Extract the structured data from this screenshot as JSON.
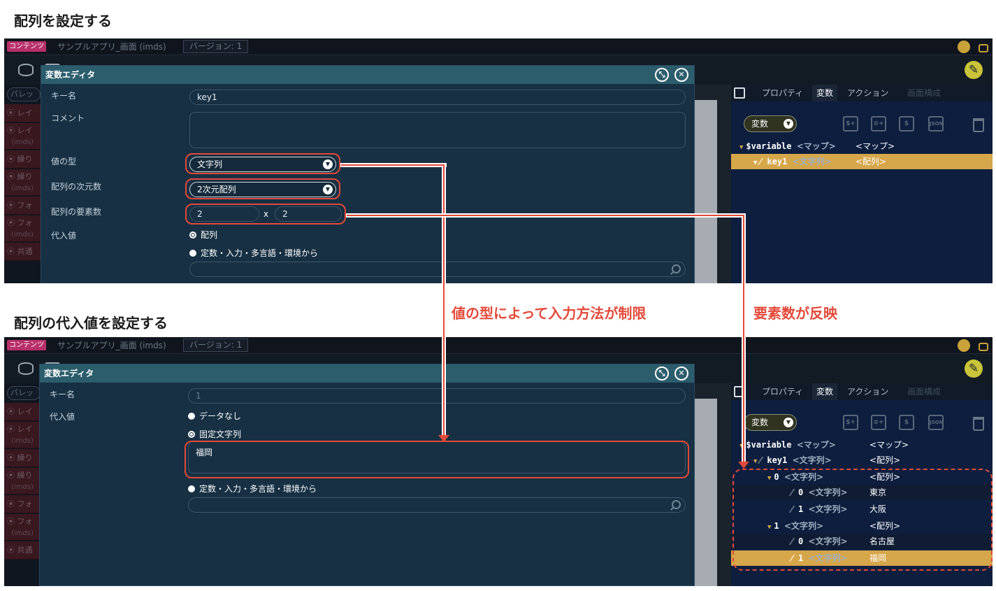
{
  "section1_heading": "配列を設定する",
  "section2_heading": "配列の代入値を設定する",
  "annotation_left": "値の型によって入力方法が制限",
  "annotation_right": "要素数が反映",
  "app": {
    "badge": "コンテンツ",
    "title": "サンプルアプリ_画面 (imds)",
    "version": "バージョン: 1"
  },
  "left_panel": {
    "search_placeholder": "パレッ",
    "items": [
      {
        "label": "⦿ レイ",
        "sub": ""
      },
      {
        "label": "⦿ レイ",
        "sub": "(imds)"
      },
      {
        "label": "⦿ 繰り",
        "sub": ""
      },
      {
        "label": "⦿ 繰り",
        "sub": "(imds)"
      },
      {
        "label": "⦿ フォ",
        "sub": ""
      },
      {
        "label": "⦿ フォ",
        "sub": "(imds)"
      },
      {
        "label": "⦿ 共通",
        "sub": ""
      }
    ]
  },
  "right_panel": {
    "tabs": [
      "プロパティ",
      "変数",
      "アクション",
      "画面構成"
    ],
    "var_button": "変数",
    "icons": [
      "$+",
      "≡+",
      "$",
      "JSON"
    ],
    "tree1": [
      {
        "key": "$variable",
        "type": "<マップ>",
        "value": "<マップ>"
      },
      {
        "key": "key1",
        "type": "<文字列>",
        "value": "<配列>"
      }
    ],
    "tree2": [
      {
        "key": "$variable",
        "type": "<マップ>",
        "value": "<マップ>"
      },
      {
        "key": "key1",
        "type": "<文字列>",
        "value": "<配列>"
      },
      {
        "key": "0",
        "type": "<文字列>",
        "value": "<配列>"
      },
      {
        "key": "0",
        "type": "<文字列>",
        "value": "東京"
      },
      {
        "key": "1",
        "type": "<文字列>",
        "value": "大阪"
      },
      {
        "key": "1",
        "type": "<文字列>",
        "value": "<配列>"
      },
      {
        "key": "0",
        "type": "<文字列>",
        "value": "名古屋"
      },
      {
        "key": "1",
        "type": "<文字列>",
        "value": "福岡"
      }
    ]
  },
  "dialog1": {
    "title": "変数エディタ",
    "key_label": "キー名",
    "key_value": "key1",
    "comment_label": "コメント",
    "type_label": "値の型",
    "type_value": "文字列",
    "dim_label": "配列の次元数",
    "dim_value": "2次元配列",
    "count_label": "配列の要素数",
    "count_a": "2",
    "count_x": "x",
    "count_b": "2",
    "assign_label": "代入値",
    "opt_array": "配列",
    "opt_const": "定数・入力・多言語・環境から"
  },
  "dialog2": {
    "title": "変数エディタ",
    "key_label": "キー名",
    "key_value": "1",
    "assign_label": "代入値",
    "opt_none": "データなし",
    "opt_fixed": "固定文字列",
    "fixed_value": "福岡",
    "opt_const": "定数・入力・多言語・環境から"
  },
  "colors": {
    "accent_red": "#e34a3a",
    "selected_row": "#d6a64a",
    "dialog_title": "#2c5d6c",
    "content_badge": "#b8306a"
  }
}
